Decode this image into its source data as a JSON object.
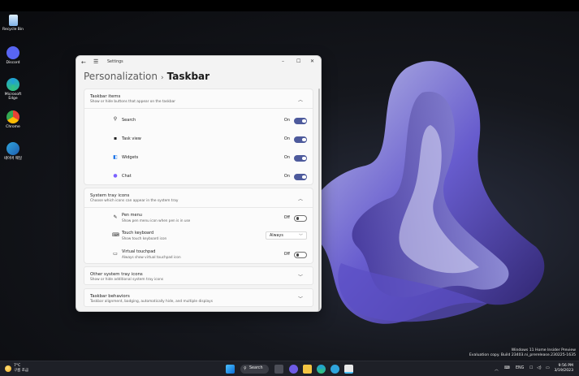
{
  "desktop": {
    "icons": [
      {
        "label": "Recycle Bin",
        "icon": "recycle-bin-icon",
        "color": "#7fb2e6"
      },
      {
        "label": "Discord",
        "icon": "discord-icon",
        "color": "#5865f2"
      },
      {
        "label": "Microsoft Edge",
        "icon": "edge-icon",
        "color": "#1fa0d6"
      },
      {
        "label": "Chrome",
        "icon": "chrome-icon",
        "color": "#e94235"
      },
      {
        "label": "네이버 웨일",
        "icon": "whale-icon",
        "color": "#2fa4dc"
      }
    ],
    "watermark": {
      "line1": "Windows 11 Home Insider Preview",
      "line2": "Evaluation copy. Build 23403.ni_prerelease.230225-1635"
    }
  },
  "window": {
    "app_title": "Settings",
    "breadcrumb": {
      "parent": "Personalization",
      "separator": "›",
      "current": "Taskbar"
    },
    "controls": {
      "minimize": "–",
      "maximize": "☐",
      "close": "✕"
    }
  },
  "sections": {
    "taskbar_items": {
      "title": "Taskbar items",
      "description": "Show or hide buttons that appear on the taskbar",
      "rows": [
        {
          "label": "Search",
          "state": "On",
          "icon": "search-icon"
        },
        {
          "label": "Task view",
          "state": "On",
          "icon": "task-view-icon"
        },
        {
          "label": "Widgets",
          "state": "On",
          "icon": "widgets-icon"
        },
        {
          "label": "Chat",
          "state": "On",
          "icon": "chat-icon"
        }
      ]
    },
    "system_tray": {
      "title": "System tray icons",
      "description": "Choose which icons can appear in the system tray",
      "pen_menu": {
        "label": "Pen menu",
        "description": "Show pen menu icon when pen is in use",
        "state": "Off"
      },
      "touch_keyboard": {
        "label": "Touch keyboard",
        "description": "Show touch keyboard icon",
        "value": "Always"
      },
      "virtual_touchpad": {
        "label": "Virtual touchpad",
        "description": "Always show virtual touchpad icon",
        "state": "Off"
      }
    },
    "other_tray": {
      "title": "Other system tray icons",
      "description": "Show or hide additional system tray icons"
    },
    "behaviors": {
      "title": "Taskbar behaviors",
      "description": "Taskbar alignment, badging, automatically hide, and multiple displays"
    }
  },
  "taskbar": {
    "weather": {
      "temp": "7°C",
      "condition": "구름 조금"
    },
    "search_label": "Search",
    "tray": {
      "language": "ENG"
    },
    "clock": {
      "time": "9:56 PM",
      "date": "3/19/2023"
    }
  },
  "colors": {
    "accent": "#4d5a9c",
    "window_bg": "#f3f3f3",
    "taskbar_bg": "#1e2027"
  }
}
